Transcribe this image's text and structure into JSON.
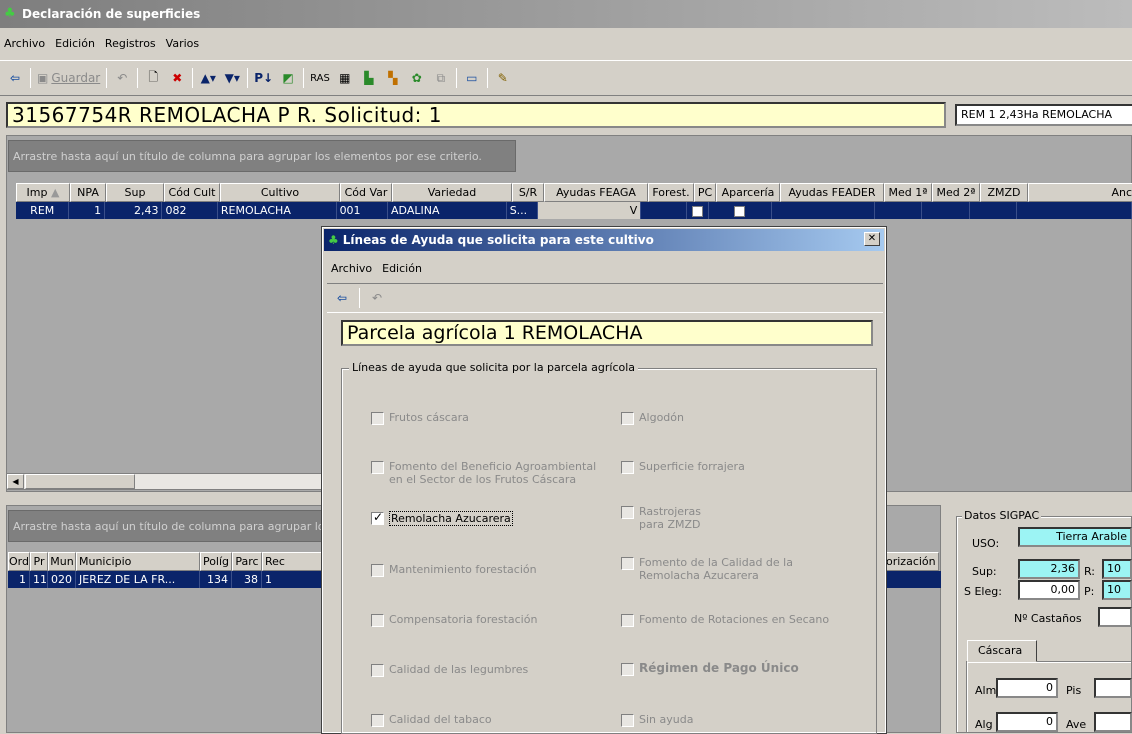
{
  "window": {
    "title": "Declaración de superficies"
  },
  "menu": [
    "Archivo",
    "Edición",
    "Registros",
    "Varios"
  ],
  "toolbar": {
    "save_label": "Guardar",
    "ras_label": "RAS"
  },
  "header": {
    "title": "31567754R REMOLACHA P R. Solicitud: 1",
    "summary": "REM 1 2,43Ha REMOLACHA"
  },
  "grid1": {
    "group_hint": "Arrastre hasta aquí un título de columna para agrupar los elementos por ese criterio.",
    "columns": [
      "Imp",
      "NPA",
      "Sup",
      "Cód Cult",
      "Cultivo",
      "Cód Var",
      "Variedad",
      "S/R",
      "Ayudas FEAGA",
      "Forest.",
      "PC",
      "Aparcería",
      "Ayudas FEADER",
      "Med 1ª",
      "Med 2ª",
      "ZMZD",
      "Anch"
    ],
    "rows": [
      {
        "imp": "REM",
        "npa": "1",
        "sup": "2,43",
        "cod_cult": "082",
        "cultivo": "REMOLACHA",
        "cod_var": "001",
        "variedad": "ADALINA",
        "sr": "S...",
        "feaga": "V",
        "forest": "",
        "pc": "",
        "aparceria": "",
        "feader": "",
        "med1": "",
        "med2": "",
        "zmzd": "",
        "anch": ""
      }
    ]
  },
  "grid2": {
    "group_hint": "Arrastre hasta aquí un título de columna para agrupar los elementos por ese criterio.",
    "columns": [
      "Ord",
      "Pr",
      "Mun",
      "Municipio",
      "Políg",
      "Parc",
      "Rec"
    ],
    "hidden_col": "orización",
    "rows": [
      {
        "ord": "1",
        "pr": "11",
        "mun": "020",
        "municipio": "JEREZ DE LA FR...",
        "polig": "134",
        "parc": "38",
        "rec": "1"
      }
    ]
  },
  "sigpac": {
    "title": "Datos SIGPAC",
    "uso_label": "USO:",
    "uso_value": "Tierra Arable",
    "sup_label": "Sup:",
    "sup_value": "2,36",
    "r_label": "R:",
    "r_value": "10",
    "seleg_label": "S Eleg:",
    "seleg_value": "0,00",
    "p_label": "P:",
    "p_value": "10",
    "castanos_label": "Nº Castaños",
    "tab": "Cáscara",
    "alm_label": "Alm",
    "alm_value": "0",
    "pis_label": "Pis",
    "alg_label": "Alg",
    "alg_value": "0",
    "ave_label": "Ave"
  },
  "dialog": {
    "title": "Líneas de Ayuda que solicita para este cultivo",
    "menu": [
      "Archivo",
      "Edición"
    ],
    "field": "Parcela agrícola 1   REMOLACHA",
    "group_label": "Líneas de ayuda que solicita por la parcela agrícola",
    "options_left": [
      {
        "label": "Frutos cáscara",
        "checked": false
      },
      {
        "label": "Fomento del Beneficio Agroambiental en el Sector de los Frutos Cáscara",
        "checked": false
      },
      {
        "label": "Remolacha Azucarera",
        "checked": true
      },
      {
        "label": "Mantenimiento forestación",
        "checked": false
      },
      {
        "label": "Compensatoria forestación",
        "checked": false
      },
      {
        "label": "Calidad de las legumbres",
        "checked": false
      },
      {
        "label": "Calidad del tabaco",
        "checked": false
      }
    ],
    "options_right": [
      {
        "label": "Algodón",
        "checked": false
      },
      {
        "label": "Superficie forrajera",
        "checked": false
      },
      {
        "label": "Rastrojeras para ZMZD",
        "checked": false
      },
      {
        "label": "Fomento de la Calidad de la Remolacha Azucarera",
        "checked": false
      },
      {
        "label": "Fomento de Rotaciones en Secano",
        "checked": false
      },
      {
        "label": "Régimen de Pago Único",
        "checked": false
      },
      {
        "label": "Sin ayuda",
        "checked": false
      }
    ]
  }
}
